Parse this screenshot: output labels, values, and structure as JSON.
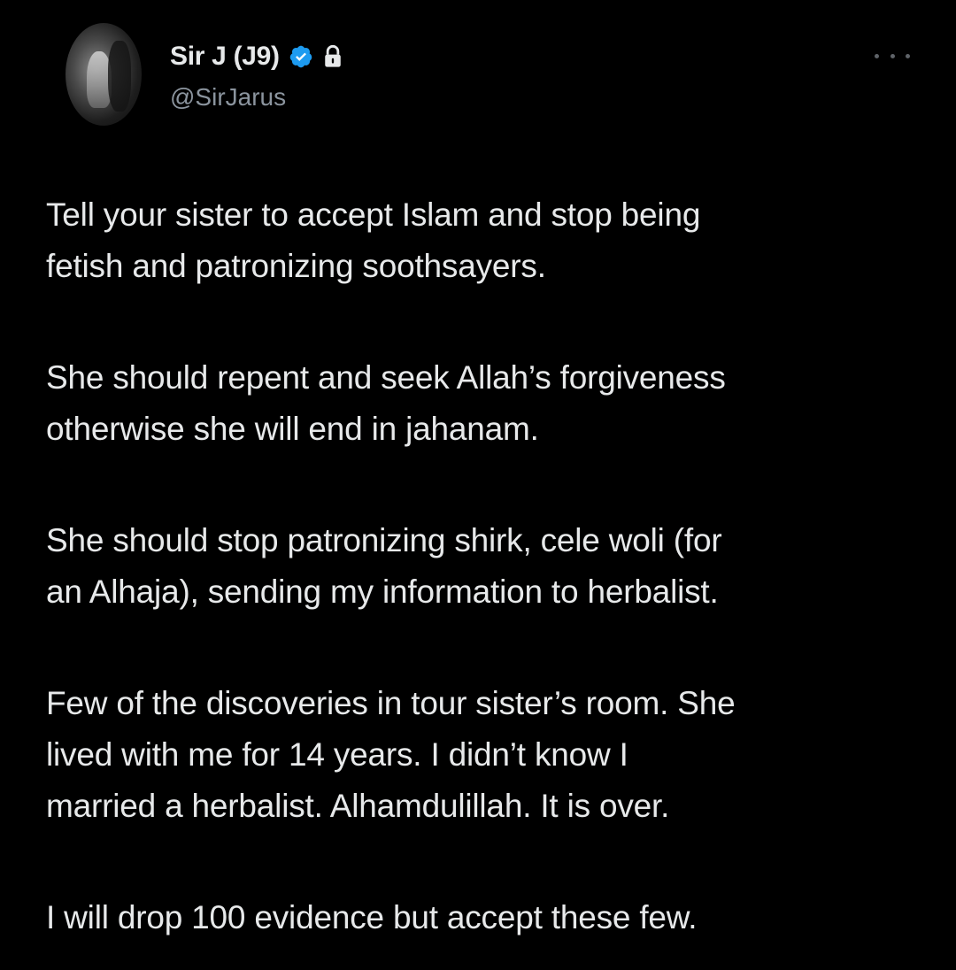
{
  "tweet": {
    "author": {
      "display_name": "Sir J (J9)",
      "handle": "@SirJarus",
      "verified_color": "#1d9bf0"
    },
    "icons": {
      "avatar": "profile-photo",
      "verified": "verified-badge-icon",
      "lock": "lock-icon",
      "more": "more-options-icon"
    },
    "paragraphs": [
      "Tell your sister to accept Islam and stop being\nfetish and patronizing soothsayers.",
      "She should repent and seek Allah’s forgiveness\notherwise she will end in jahanam.",
      "She should stop patronizing shirk, cele woli (for\nan Alhaja), sending my information to herbalist.",
      "Few of the discoveries in tour sister’s room. She\nlived with me for 14 years. I didn’t know I\nmarried a herbalist. Alhamdulillah. It is over.",
      "I will drop 100 evidence but accept these few."
    ]
  }
}
